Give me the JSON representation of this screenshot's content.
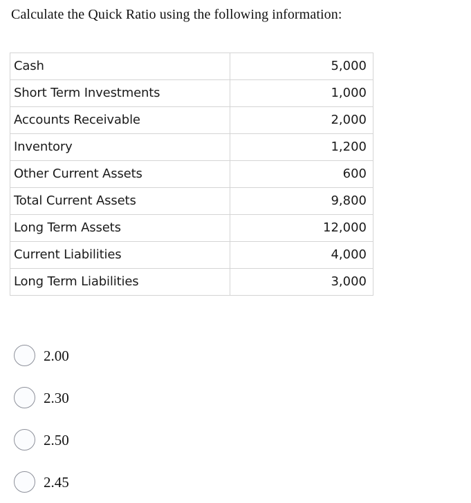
{
  "question": {
    "prompt": "Calculate the Quick Ratio using the following information:"
  },
  "table": {
    "rows": [
      {
        "label": "Cash",
        "value": "5,000"
      },
      {
        "label": "Short Term Investments",
        "value": "1,000"
      },
      {
        "label": "Accounts Receivable",
        "value": "2,000"
      },
      {
        "label": "Inventory",
        "value": "1,200"
      },
      {
        "label": "Other Current Assets",
        "value": "600"
      },
      {
        "label": "Total Current Assets",
        "value": "9,800"
      },
      {
        "label": "Long Term Assets",
        "value": "12,000"
      },
      {
        "label": "Current Liabilities",
        "value": "4,000"
      },
      {
        "label": "Long Term Liabilities",
        "value": "3,000"
      }
    ],
    "border_color": "#d4d4d4"
  },
  "answers": {
    "selected": null,
    "options": [
      {
        "label": "2.00",
        "selected": false
      },
      {
        "label": "2.30",
        "selected": false
      },
      {
        "label": "2.50",
        "selected": false
      },
      {
        "label": "2.45",
        "selected": false
      }
    ]
  }
}
